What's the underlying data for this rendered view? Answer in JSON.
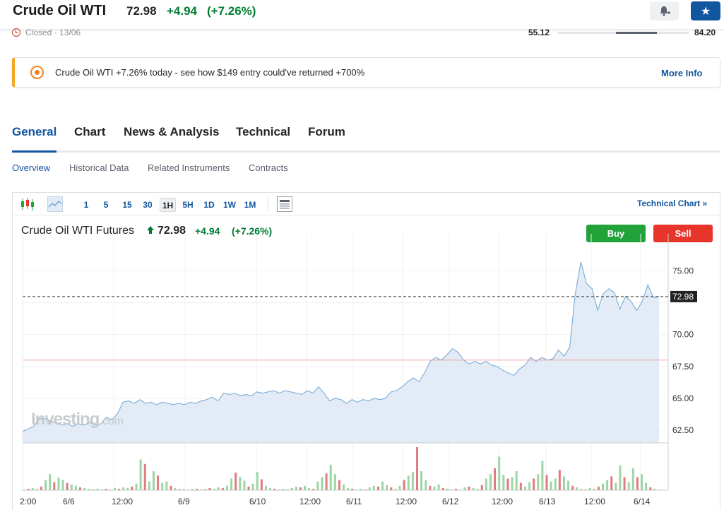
{
  "header": {
    "title": "Crude Oil WTI",
    "price": "72.98",
    "change": "+4.94",
    "change_pct": "(+7.26%)",
    "status": "Closed · 13/06",
    "range_low": "55.12",
    "range_high": "84.20",
    "range_position": 0.6
  },
  "promo": {
    "text": "Crude Oil WTI +7.26% today - see how $149 entry could've returned +700%",
    "link": "More Info"
  },
  "tabs": [
    "General",
    "Chart",
    "News & Analysis",
    "Technical",
    "Forum"
  ],
  "active_tab": "General",
  "subtabs": [
    "Overview",
    "Historical Data",
    "Related Instruments",
    "Contracts"
  ],
  "active_subtab": "Overview",
  "toolbar": {
    "intervals": [
      "1",
      "5",
      "15",
      "30",
      "1H",
      "5H",
      "1D",
      "1W",
      "1M"
    ],
    "active_interval": "1H",
    "technical_chart_link": "Technical Chart »"
  },
  "chart_header": {
    "title": "Crude Oil WTI Futures",
    "price": "72.98",
    "change": "+4.94",
    "change_pct": "(+7.26%)",
    "buy_label": "Buy",
    "sell_label": "Sell"
  },
  "watermark": {
    "brand": "Investing",
    "suffix": ".com"
  },
  "colors": {
    "accent": "#1256a0",
    "positive": "#007c32",
    "negative": "#e8352b",
    "line": "#6ea6d4",
    "area": "#e3ecf6",
    "volume_up": "#9dd5a5",
    "volume_down": "#e07b80"
  },
  "chart_data": {
    "type": "area",
    "x_ticks": [
      "2:00",
      "6/6",
      "12:00",
      "6/9",
      "6/10",
      "12:00",
      "6/11",
      "12:00",
      "6/12",
      "12:00",
      "6/13",
      "12:00",
      "6/14"
    ],
    "y_ticks": [
      75.0,
      72.5,
      70.0,
      67.5,
      65.0,
      62.5
    ],
    "y_tick_labels": [
      "75.00",
      "72.98",
      "70.00",
      "67.50",
      "65.00",
      "62.50"
    ],
    "ylim": [
      61.5,
      76.8
    ],
    "last_price": 72.98,
    "reference_line": 68.0,
    "prices": [
      62.4,
      62.6,
      62.8,
      63.4,
      63.4,
      63.2,
      63.1,
      62.9,
      63.0,
      62.8,
      63.0,
      62.9,
      63.1,
      62.9,
      63.0,
      63.5,
      63.3,
      63.8,
      64.7,
      64.8,
      64.6,
      64.9,
      64.6,
      64.7,
      64.5,
      64.7,
      64.6,
      64.5,
      64.6,
      64.5,
      64.7,
      64.6,
      64.8,
      64.9,
      65.1,
      64.8,
      65.4,
      65.3,
      65.4,
      65.2,
      65.3,
      65.2,
      65.5,
      65.4,
      65.5,
      65.6,
      65.4,
      65.6,
      65.5,
      65.4,
      65.3,
      65.6,
      65.4,
      65.9,
      65.4,
      64.8,
      65.0,
      64.9,
      64.6,
      64.9,
      64.7,
      64.9,
      64.8,
      65.0,
      64.9,
      65.0,
      65.5,
      65.6,
      65.9,
      66.3,
      66.6,
      66.3,
      67.0,
      67.9,
      68.2,
      68.0,
      68.4,
      68.9,
      68.6,
      68.0,
      67.7,
      67.9,
      67.7,
      67.9,
      67.6,
      67.5,
      67.2,
      67.0,
      66.8,
      67.3,
      67.6,
      68.2,
      67.9,
      68.2,
      68.0,
      68.1,
      68.8,
      68.3,
      69.0,
      73.2,
      75.7,
      74.0,
      73.6,
      71.9,
      73.2,
      73.6,
      73.3,
      72.0,
      73.0,
      72.6,
      71.9,
      72.6,
      73.9,
      72.9,
      72.98
    ],
    "volumes": [
      1,
      2,
      3,
      2,
      5,
      14,
      22,
      11,
      17,
      14,
      10,
      8,
      6,
      4,
      3,
      2,
      1,
      2,
      1,
      2,
      1,
      3,
      2,
      4,
      3,
      5,
      9,
      42,
      36,
      12,
      26,
      20,
      10,
      12,
      6,
      3,
      2,
      1,
      1,
      2,
      2,
      1,
      2,
      3,
      2,
      4,
      3,
      6,
      16,
      24,
      18,
      13,
      5,
      9,
      25,
      15,
      6,
      3,
      2,
      1,
      2,
      1,
      3,
      5,
      4,
      6,
      3,
      2,
      12,
      18,
      23,
      35,
      22,
      14,
      8,
      3,
      2,
      1,
      2,
      1,
      4,
      6,
      5,
      12,
      7,
      4,
      2,
      6,
      14,
      20,
      25,
      59,
      26,
      14,
      6,
      5,
      8,
      3,
      2,
      1,
      2,
      1,
      4,
      5,
      3,
      2,
      7,
      16,
      22,
      30,
      46,
      21,
      16,
      18,
      26,
      10,
      5,
      11,
      16,
      22,
      40,
      21,
      12,
      16,
      28,
      19,
      13,
      6,
      4,
      2,
      1,
      3,
      2,
      5,
      9,
      14,
      19,
      10,
      34,
      18,
      11,
      30,
      18,
      22,
      10,
      4,
      2,
      1
    ]
  }
}
